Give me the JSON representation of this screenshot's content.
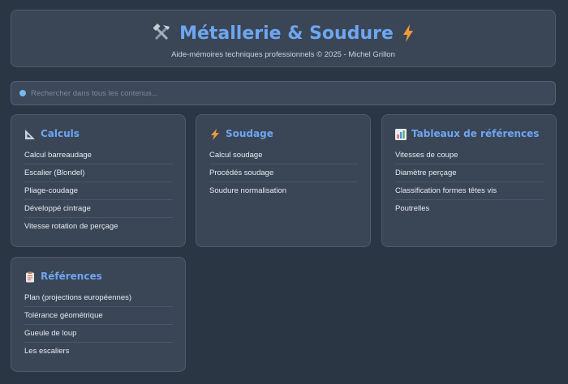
{
  "header": {
    "title": "Métallerie & Soudure",
    "subtitle": "Aide-mémoires techniques professionnels © 2025 - Michel Grillon"
  },
  "search": {
    "placeholder": "Rechercher dans tous les contenus..."
  },
  "cards": [
    {
      "icon": "ruler-triangle-icon",
      "title": "Calculs",
      "items": [
        "Calcul barreaudage",
        "Escalier (Blondel)",
        "Pliage-coudage",
        "Développé cintrage",
        "Vitesse rotation de perçage"
      ]
    },
    {
      "icon": "lightning-icon",
      "title": "Soudage",
      "items": [
        "Calcul soudage",
        "Procédés soudage",
        "Soudure normalisation"
      ]
    },
    {
      "icon": "bar-chart-icon",
      "title": "Tableaux de références",
      "items": [
        "Vitesses de coupe",
        "Diamètre perçage",
        "Classification formes têtes vis",
        "Poutrelles"
      ]
    },
    {
      "icon": "clipboard-icon",
      "title": "Références",
      "items": [
        "Plan (projections européennes)",
        "Tolérance géométrique",
        "Gueule de loup",
        "Les escaliers"
      ]
    }
  ],
  "colors": {
    "background": "#2b3645",
    "card": "#3a4556",
    "accent": "#6ea6f0"
  }
}
